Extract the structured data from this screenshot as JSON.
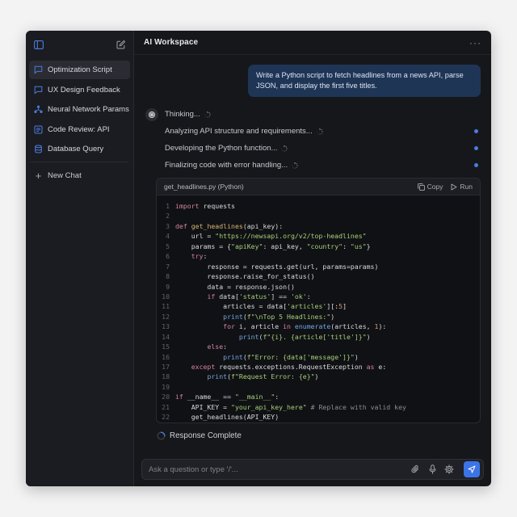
{
  "app": {
    "title": "AI Workspace"
  },
  "sidebar": {
    "items": [
      {
        "label": "Optimization Script",
        "icon": "chat-bubble-icon",
        "active": true
      },
      {
        "label": "UX Design Feedback",
        "icon": "chat-bubble-icon"
      },
      {
        "label": "Neural Network Params",
        "icon": "network-icon"
      },
      {
        "label": "Code Review: API",
        "icon": "code-doc-icon"
      },
      {
        "label": "Database Query",
        "icon": "database-icon"
      }
    ],
    "new_chat": "New Chat"
  },
  "conversation": {
    "user_message": "Write a Python script to fetch headlines from a news API, parse JSON, and display the first five titles.",
    "thinking": "Thinking...",
    "steps": [
      "Analyzing API structure and requirements...",
      "Developing the Python function...",
      "Finalizing code with error handling..."
    ],
    "response_status": "Response Complete"
  },
  "code_block": {
    "filename": "get_headlines.py (Python)",
    "copy_label": "Copy",
    "run_label": "Run",
    "lines": [
      "import requests",
      "",
      "def get_headlines(api_key):",
      "    url = \"https://newsapi.org/v2/top-headlines\"",
      "    params = {\"apiKey\": api_key, \"country\": \"us\"}",
      "    try:",
      "        response = requests.get(url, params=params)",
      "        response.raise_for_status()",
      "        data = response.json()",
      "        if data['status'] == 'ok':",
      "            articles = data['articles'][:5]",
      "            print(f\"\\nTop 5 Headlines:\")",
      "            for i, article in enumerate(articles, 1):",
      "                print(f\"{i}. {article['title']}\")",
      "        else:",
      "            print(f\"Error: {data['message']}\")",
      "    except requests.exceptions.RequestException as e:",
      "        print(f\"Request Error: {e}\")",
      "",
      "if __name__ == \"__main__\":",
      "    API_KEY = \"your_api_key_here\" # Replace with valid key",
      "    get_headlines(API_KEY)"
    ]
  },
  "input": {
    "placeholder": "Ask a question or type '/'...",
    "value": ""
  },
  "colors": {
    "accent": "#3b74e6",
    "user_bubble": "#1f3556",
    "window_bg": "#16171b"
  }
}
